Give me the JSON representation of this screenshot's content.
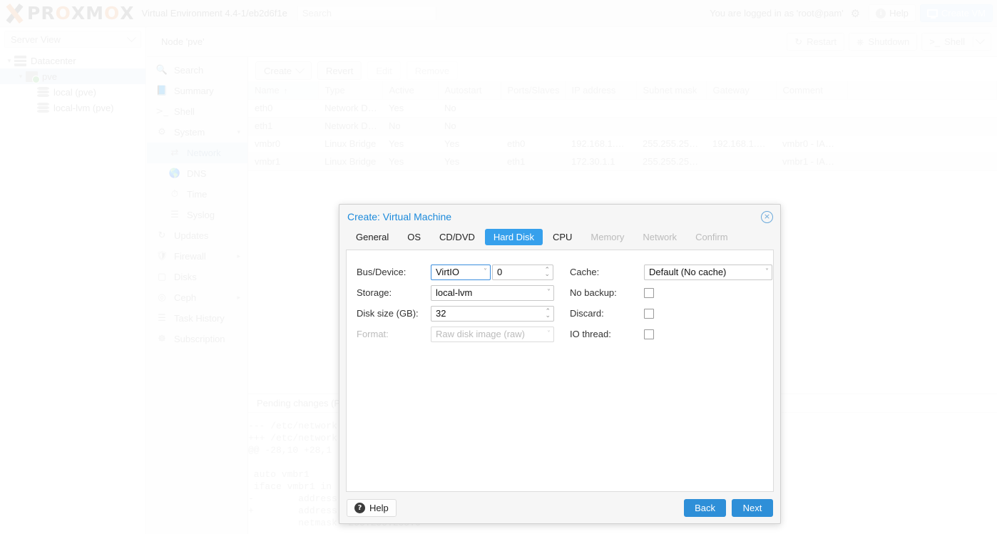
{
  "header": {
    "logo_text": "PROXMOX",
    "version": "Virtual Environment 4.4-1/eb2d6f1e",
    "search_placeholder": "Search",
    "login_status": "You are logged in as 'root@pam'",
    "help_label": "Help",
    "create_vm_label": "Create VM",
    "accent_orange": "#e8a06a",
    "accent_blue": "#36a0ec"
  },
  "sidebar": {
    "view_label": "Server View",
    "tree": [
      {
        "label": "Datacenter",
        "icon": "datacenter-icon",
        "depth": 0,
        "selected": false
      },
      {
        "label": "pve",
        "icon": "node-icon",
        "depth": 1,
        "selected": true
      },
      {
        "label": "local (pve)",
        "icon": "storage-icon",
        "depth": 2,
        "selected": false
      },
      {
        "label": "local-lvm (pve)",
        "icon": "storage-icon",
        "depth": 2,
        "selected": false
      }
    ]
  },
  "contentnav": {
    "items": [
      {
        "label": "Search",
        "icon": "search-icon",
        "sub": false,
        "active": false,
        "caret": ""
      },
      {
        "label": "Summary",
        "icon": "book-icon",
        "sub": false,
        "active": false,
        "caret": ""
      },
      {
        "label": "Shell",
        "icon": "terminal-icon",
        "sub": false,
        "active": false,
        "caret": ""
      },
      {
        "label": "System",
        "icon": "gears-icon",
        "sub": false,
        "active": false,
        "caret": "▾"
      },
      {
        "label": "Network",
        "icon": "network-icon",
        "sub": true,
        "active": true,
        "caret": ""
      },
      {
        "label": "DNS",
        "icon": "globe-icon",
        "sub": true,
        "active": false,
        "caret": ""
      },
      {
        "label": "Time",
        "icon": "clock-icon",
        "sub": true,
        "active": false,
        "caret": ""
      },
      {
        "label": "Syslog",
        "icon": "list-icon",
        "sub": true,
        "active": false,
        "caret": ""
      },
      {
        "label": "Updates",
        "icon": "refresh-icon",
        "sub": false,
        "active": false,
        "caret": ""
      },
      {
        "label": "Firewall",
        "icon": "shield-icon",
        "sub": false,
        "active": false,
        "caret": "▸"
      },
      {
        "label": "Disks",
        "icon": "disk-icon",
        "sub": false,
        "active": false,
        "caret": ""
      },
      {
        "label": "Ceph",
        "icon": "ceph-icon",
        "sub": false,
        "active": false,
        "caret": "▸"
      },
      {
        "label": "Task History",
        "icon": "list-icon",
        "sub": false,
        "active": false,
        "caret": ""
      },
      {
        "label": "Subscription",
        "icon": "lifebuoy-icon",
        "sub": false,
        "active": false,
        "caret": ""
      }
    ]
  },
  "node_header": {
    "title": "Node 'pve'",
    "restart_label": "Restart",
    "shutdown_label": "Shutdown",
    "shell_label": "Shell"
  },
  "main": {
    "toolbar": {
      "create_label": "Create",
      "revert_label": "Revert",
      "edit_label": "Edit",
      "remove_label": "Remove"
    },
    "table": {
      "columns": [
        "Name",
        "Type",
        "Active",
        "Autostart",
        "Ports/Slaves",
        "IP address",
        "Subnet mask",
        "Gateway",
        "Comment"
      ],
      "sort_column": "Name",
      "sort_arrow": "↑",
      "rows": [
        {
          "name": "eth0",
          "type": "Network De…",
          "active": "Yes",
          "autostart": "No",
          "ports": "",
          "ip": "",
          "mask": "",
          "gateway": "",
          "comment": ""
        },
        {
          "name": "eth1",
          "type": "Network De…",
          "active": "No",
          "autostart": "No",
          "ports": "",
          "ip": "",
          "mask": "",
          "gateway": "",
          "comment": ""
        },
        {
          "name": "vmbr0",
          "type": "Linux Bridge",
          "active": "Yes",
          "autostart": "Yes",
          "ports": "eth0",
          "ip": "192.168.1.…",
          "mask": "255.255.25…",
          "gateway": "192.168.1.…",
          "comment": "vmbr0 - IA…"
        },
        {
          "name": "vmbr1",
          "type": "Linux Bridge",
          "active": "Yes",
          "autostart": "Yes",
          "ports": "eth1",
          "ip": "172.30.1.1",
          "mask": "255.255.25…",
          "gateway": "",
          "comment": "vmbr1 - IA…"
        }
      ]
    },
    "pending": {
      "title": "Pending changes (P",
      "diff": "--- /etc/network\n+++ /etc/network\n@@ -28,10 +28,1\n\n auto vmbr1\n iface vmbr1 in\n-        address\n+        address\n         netmask  255.255.255.0"
    }
  },
  "modal": {
    "title": "Create: Virtual Machine",
    "close_icon_label": "×",
    "tabs": [
      {
        "label": "General",
        "active": false,
        "disabled": false
      },
      {
        "label": "OS",
        "active": false,
        "disabled": false
      },
      {
        "label": "CD/DVD",
        "active": false,
        "disabled": false
      },
      {
        "label": "Hard Disk",
        "active": true,
        "disabled": false
      },
      {
        "label": "CPU",
        "active": false,
        "disabled": false
      },
      {
        "label": "Memory",
        "active": false,
        "disabled": true
      },
      {
        "label": "Network",
        "active": false,
        "disabled": true
      },
      {
        "label": "Confirm",
        "active": false,
        "disabled": true
      }
    ],
    "left_fields": {
      "bus_device_label": "Bus/Device:",
      "bus_device_value": "VirtIO",
      "device_number_value": "0",
      "storage_label": "Storage:",
      "storage_value": "local-lvm",
      "disk_size_label": "Disk size (GB):",
      "disk_size_value": "32",
      "format_label": "Format:",
      "format_value": "Raw disk image (raw)",
      "format_disabled": true
    },
    "right_fields": {
      "cache_label": "Cache:",
      "cache_value": "Default (No cache)",
      "no_backup_label": "No backup:",
      "no_backup_checked": false,
      "discard_label": "Discard:",
      "discard_checked": false,
      "io_thread_label": "IO thread:",
      "io_thread_checked": false
    },
    "footer": {
      "help_label": "Help",
      "back_label": "Back",
      "next_label": "Next"
    }
  }
}
